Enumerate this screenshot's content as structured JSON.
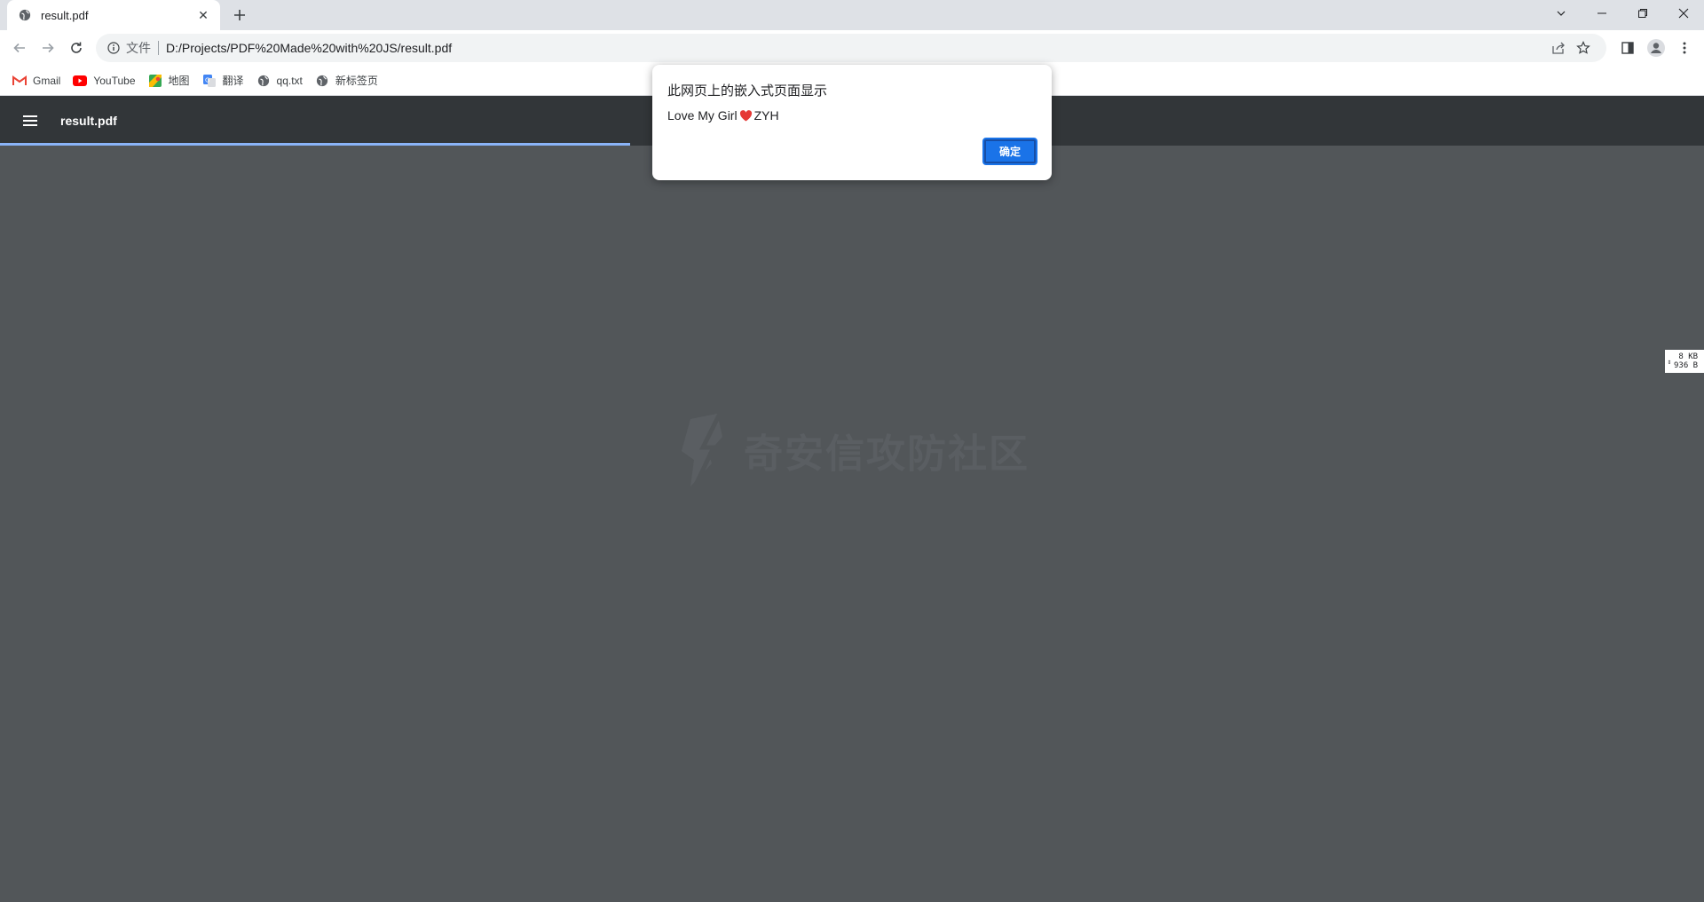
{
  "tab": {
    "title": "result.pdf",
    "close_glyph": "✕"
  },
  "window_controls": [
    "chevron-down-icon",
    "minimize-icon",
    "restore-icon",
    "close-icon"
  ],
  "omnibox": {
    "scheme_label": "文件",
    "url": "D:/Projects/PDF%20Made%20with%20JS/result.pdf"
  },
  "bookmarks": [
    {
      "label": "Gmail",
      "icon": "gmail-icon"
    },
    {
      "label": "YouTube",
      "icon": "youtube-icon"
    },
    {
      "label": "地图",
      "icon": "maps-icon"
    },
    {
      "label": "翻译",
      "icon": "translate-icon"
    },
    {
      "label": "qq.txt",
      "icon": "globe-icon"
    },
    {
      "label": "新标签页",
      "icon": "globe-icon"
    }
  ],
  "pdf": {
    "title": "result.pdf",
    "load_progress": 0.37
  },
  "dialog": {
    "title": "此网页上的嵌入式页面显示",
    "message_before": "Love My Girl",
    "message_after": "ZYH",
    "ok_label": "确定"
  },
  "watermark": {
    "text": "奇安信攻防社区"
  },
  "side_widget": {
    "line1": "8 KB",
    "line2": "936 B"
  },
  "colors": {
    "accent": "#1a73e8",
    "pdf_toolbar": "#323639",
    "pdf_background": "#525659",
    "progress": "#8ab4f8",
    "heart": "#e53935"
  }
}
